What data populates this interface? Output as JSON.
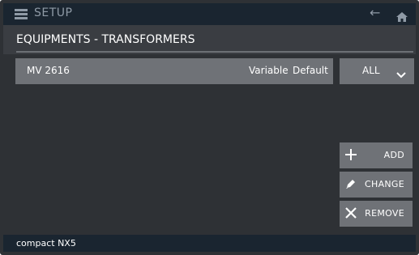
{
  "titlebar": {
    "title": "SETUP",
    "menu_icon": "menu-icon",
    "back_icon": "arrow-left-icon",
    "home_icon": "home-icon"
  },
  "page": {
    "title": "EQUIPMENTS - TRANSFORMERS"
  },
  "list": {
    "rows": [
      {
        "name": "MV 2616",
        "type": "Variable",
        "status": "Default"
      }
    ]
  },
  "filter": {
    "selected": "ALL",
    "icon": "chevron-down-icon"
  },
  "actions": {
    "add": "ADD",
    "change": "CHANGE",
    "remove": "REMOVE"
  },
  "footer": {
    "device": "compact NX5"
  },
  "colors": {
    "titlebar_bg": "#1a2530",
    "panel_bg": "#2e3135",
    "button_bg": "#6f7277",
    "text": "#ffffff",
    "muted_text": "#8f9aa6"
  }
}
